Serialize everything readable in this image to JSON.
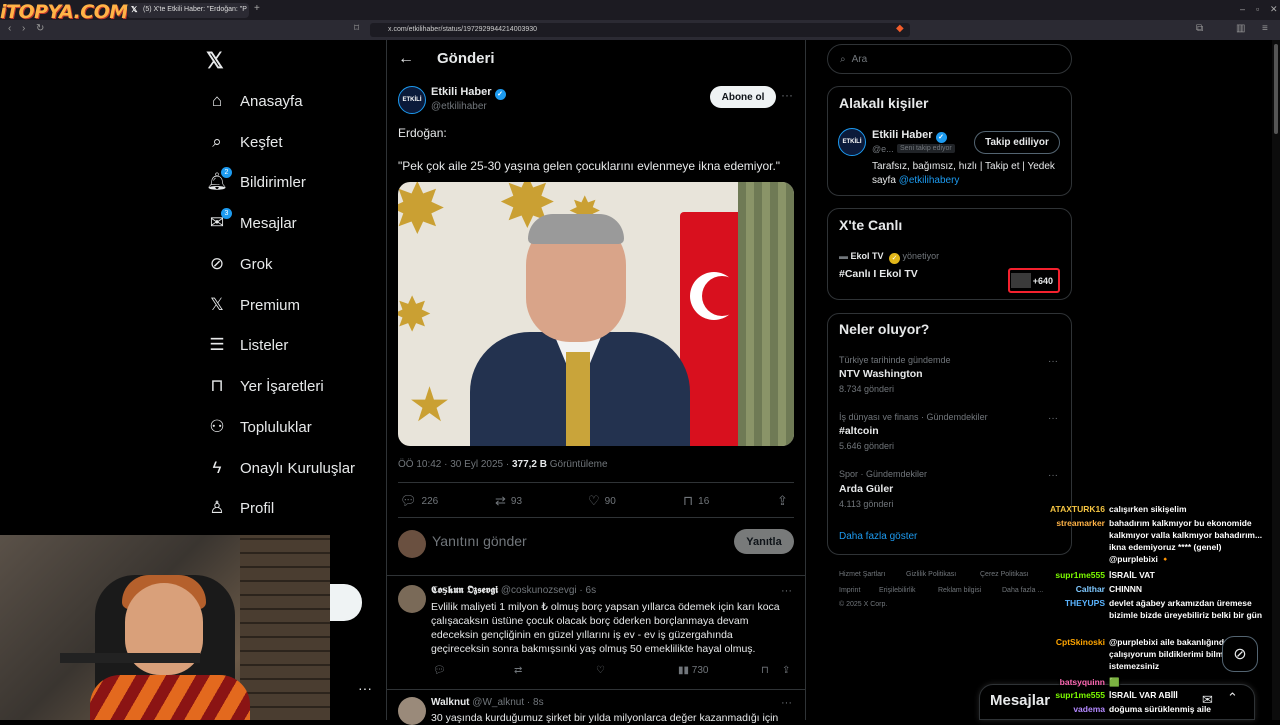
{
  "browser": {
    "logo": "iTOPYA.COM",
    "tab_title": "(5) X'te Etkili Haber: \"Erdoğan: \"P",
    "url": "x.com/etkilihaber/status/1972929944214003930"
  },
  "nav": {
    "items": [
      {
        "label": "Anasayfa",
        "icon": "home-icon"
      },
      {
        "label": "Keşfet",
        "icon": "search-icon"
      },
      {
        "label": "Bildirimler",
        "icon": "bell-icon",
        "badge": "2"
      },
      {
        "label": "Mesajlar",
        "icon": "mail-icon",
        "badge": "3"
      },
      {
        "label": "Grok",
        "icon": "grok-icon"
      },
      {
        "label": "Premium",
        "icon": "x-icon"
      },
      {
        "label": "Listeler",
        "icon": "list-icon"
      },
      {
        "label": "Yer İşaretleri",
        "icon": "bookmark-icon"
      },
      {
        "label": "Topluluklar",
        "icon": "communities-icon"
      },
      {
        "label": "Onaylı Kuruluşlar",
        "icon": "lightning-icon"
      },
      {
        "label": "Profil",
        "icon": "person-icon"
      }
    ]
  },
  "post": {
    "header_title": "Gönderi",
    "author_name": "Etkili Haber",
    "author_handle": "@etkilihaber",
    "follow_label": "Abone ol",
    "text_line1": "Erdoğan:",
    "text_line2": "\"Pek çok aile 25-30 yaşına gelen çocuklarını evlenmeye ikna edemiyor.\"",
    "time": "ÖÖ 10:42 · 30 Eyl 2025 · ",
    "views": "377,2 B",
    "views_label": " Görüntüleme",
    "replies": "226",
    "reposts": "93",
    "likes": "90",
    "bookmarks": "16"
  },
  "reply": {
    "placeholder": "Yanıtını gönder",
    "button": "Yanıtla"
  },
  "comments": [
    {
      "name": "𝕮𝖔ş𝖐𝖚𝖓 𝕺𝖟𝖘𝖊𝖛𝖌𝖎",
      "handle": "@coskunozsevgi · 6s",
      "text": "Evlilik maliyeti 1 milyon ₺ olmuş borç yapsan yıllarca ödemek için karı koca çalışacaksın üstüne çocuk olacak borç öderken borçlanmaya devam edeceksin gençliğinin en güzel yıllarını iş ev - ev iş güzergahında geçireceksin sonra bakmışsınki yaş olmuş 50 emeklilikte hayal olmuş.",
      "views": "730"
    },
    {
      "name": "Walknut",
      "handle": "@W_alknut · 8s",
      "text": "30 yaşında kurduğumuz şirket bir yılda milyonlarca değer kazanmadığı için"
    }
  ],
  "right": {
    "search_placeholder": "Ara",
    "related_title": "Alakalı kişiler",
    "related_name": "Etkili Haber",
    "related_handle": "@e...",
    "related_tag": "Seni takip ediyor",
    "related_button": "Takip ediliyor",
    "related_bio": "Tarafsız, bağımsız, hızlı | Takip et | Yedek sayfa ",
    "related_bio_link": "@etkilihabery",
    "live_title": "X'te Canlı",
    "live_host": "Ekol TV",
    "live_host_suffix": " yönetiyor",
    "live_name": "#Canlı I Ekol TV",
    "live_count": "+640",
    "trends_title": "Neler oluyor?",
    "trends": [
      {
        "context": "Türkiye tarihinde gündemde",
        "name": "NTV Washington",
        "count": "8.734 gönderi"
      },
      {
        "context": "İş dünyası ve finans · Gündemdekiler",
        "name": "#altcoin",
        "count": "5.646 gönderi"
      },
      {
        "context": "Spor · Gündemdekiler",
        "name": "Arda Güler",
        "count": "4.113 gönderi"
      }
    ],
    "show_more": "Daha fazla göster",
    "footer": [
      "Hizmet Şartları",
      "Gizlilik Politikası",
      "Çerez Politikası",
      "Imprint",
      "Erişilebilirlik",
      "Reklam bilgisi",
      "Daha fazla ...",
      "© 2025 X Corp."
    ]
  },
  "chat": [
    {
      "user": "ATAXTURK16",
      "color": "#f5c542",
      "text": "calışırken sikişelim"
    },
    {
      "user": "streamarker",
      "color": "#ffb347",
      "text": "bahadırım kalkmıyor bu ekonomide kalkmıyor valla kalkmıyor bahadırım... ikna edemiyoruz **** (genel) @purplebixi 🔸"
    },
    {
      "user": "supr1me555",
      "color": "#7cfc00",
      "text": "İSRAİL VAT"
    },
    {
      "user": "Calthar",
      "color": "#7ec8ff",
      "text": "CHINNN"
    },
    {
      "user": "THEYUPS",
      "color": "#5ab4ff",
      "text": "devlet ağabey arkamızdan üremese bizimle bizde üreyebiliriz belki bir gün"
    },
    {
      "user": "CptSkinoski",
      "color": "#ffa500",
      "text": "@purplebixi aile bakanlığında çalışıyorum bildiklerimi bilmek istemezsiniz"
    },
    {
      "user": "batsyquinn",
      "color": "#ff69b4",
      "text": "🟩"
    },
    {
      "user": "supr1me555",
      "color": "#7cfc00",
      "text": "İSRAİL VAR ABİİİ"
    },
    {
      "user": "vadema",
      "color": "#b388ff",
      "text": "doğuma sürüklenmiş aile"
    }
  ],
  "messages_bar": {
    "title": "Mesajlar"
  },
  "colors": {
    "accent": "#1d9bf0",
    "live_red": "#f4212e",
    "background": "#000000"
  }
}
